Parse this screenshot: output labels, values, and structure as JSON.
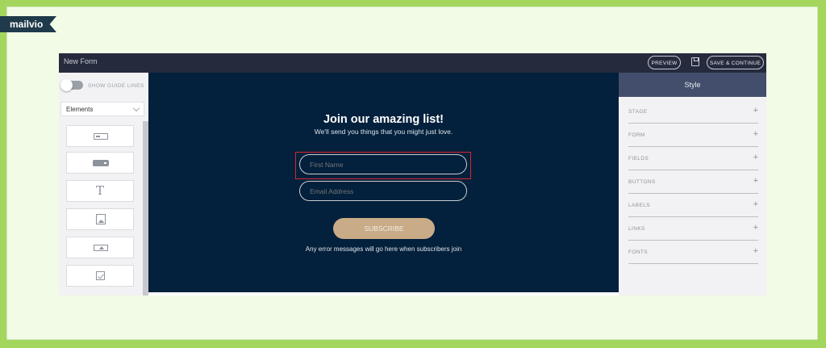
{
  "brand": {
    "name": "mailvio"
  },
  "topbar": {
    "title": "New Form",
    "preview_label": "PREVIEW",
    "save_label": "SAVE & CONTINUE"
  },
  "left_panel": {
    "guide_lines_label": "SHOW GUIDE LINES",
    "guide_lines_enabled": false,
    "dropdown_value": "Elements",
    "element_icons": [
      "text-field-icon",
      "button-icon",
      "text-icon",
      "image-icon",
      "embed-icon",
      "checkbox-icon"
    ],
    "text_icon_glyph": "T"
  },
  "canvas": {
    "background": "#03203c",
    "headline": "Join our amazing list!",
    "subheadline": "We'll send you things that you might just love.",
    "first_name_placeholder": "First Name",
    "email_placeholder": "Email Address",
    "subscribe_label": "SUBSCRIBE",
    "subscribe_color": "#c9ab87",
    "error_message": "Any error messages will go here when subscribers join",
    "highlight_color": "#d7262f"
  },
  "right_panel": {
    "title": "Style",
    "header_color": "#434e6c",
    "sections": [
      {
        "label": "STAGE",
        "icon": "plus-icon"
      },
      {
        "label": "FORM",
        "icon": "plus-icon"
      },
      {
        "label": "FIELDS",
        "icon": "plus-icon"
      },
      {
        "label": "BUTTONS",
        "icon": "plus-icon"
      },
      {
        "label": "LABELS",
        "icon": "plus-icon"
      },
      {
        "label": "LINKS",
        "icon": "plus-icon"
      },
      {
        "label": "FONTS",
        "icon": "plus-icon"
      }
    ],
    "plus_glyph": "+"
  }
}
